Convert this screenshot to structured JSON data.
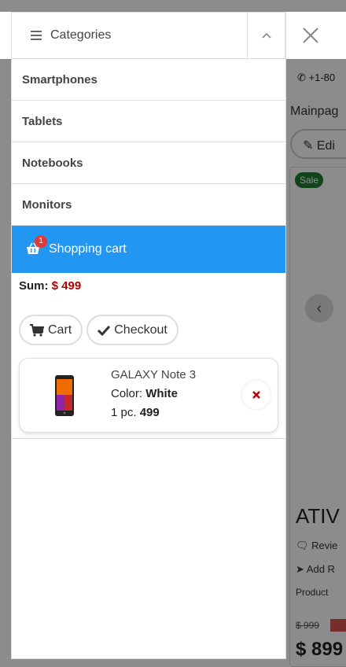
{
  "background": {
    "phone_text": "+1-80",
    "breadcrumb": "Mainpag",
    "edit_label": "Edi",
    "sale_badge": "Sale",
    "carousel_prev": "‹",
    "product_title": "ATIV",
    "reviews_text": "Revie",
    "add_review_text": "Add R",
    "product_text": "Product",
    "old_price": "$ 999",
    "price": "$ 899"
  },
  "sidebar": {
    "header_title": "Categories",
    "categories": [
      {
        "label": "Smartphones"
      },
      {
        "label": "Tablets"
      },
      {
        "label": "Notebooks"
      },
      {
        "label": "Monitors"
      }
    ]
  },
  "cart": {
    "title": "Shopping cart",
    "badge_count": "1",
    "sum_label": "Sum:",
    "sum_value": "$ 499",
    "cart_button": "Cart",
    "checkout_button": "Checkout",
    "items": [
      {
        "name": "GALAXY Note 3",
        "color_label": "Color:",
        "color_value": "White",
        "qty_label": "1 pc.",
        "price": "499"
      }
    ]
  },
  "colors": {
    "accent": "#2196f3",
    "price_red": "#b30000",
    "badge_red": "#e53935"
  },
  "icons": [
    "phone-icon",
    "pencil-icon",
    "close-icon",
    "menu-icon",
    "chevron-up-icon",
    "basket-icon",
    "cart-icon",
    "check-icon",
    "remove-icon"
  ]
}
